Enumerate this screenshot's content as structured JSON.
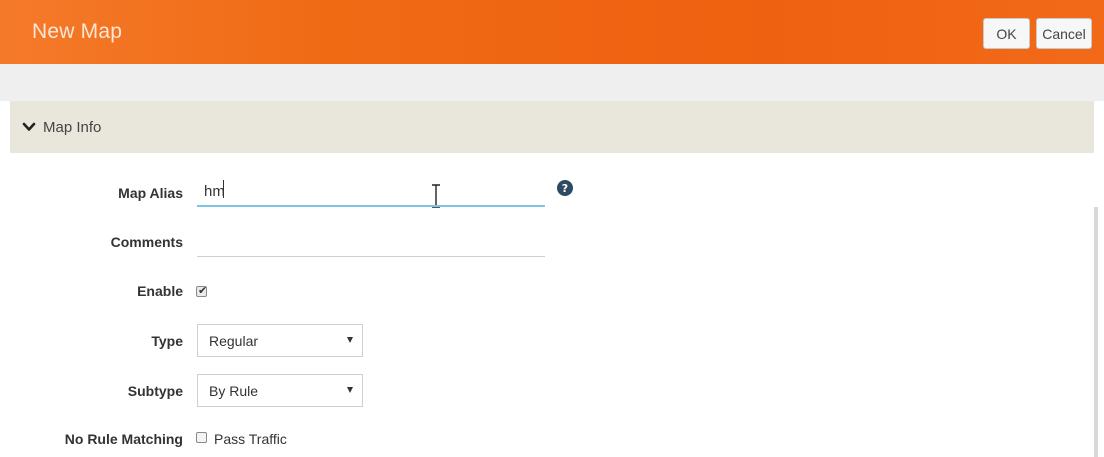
{
  "header": {
    "title": "New Map",
    "ok_label": "OK",
    "cancel_label": "Cancel",
    "accent_color": "#ee6110"
  },
  "section": {
    "title": "Map Info",
    "icon": "chevron-down-icon"
  },
  "form": {
    "map_alias": {
      "label": "Map Alias",
      "value": "hm",
      "help_icon": "question-icon"
    },
    "comments": {
      "label": "Comments",
      "value": ""
    },
    "enable": {
      "label": "Enable",
      "checked": true
    },
    "type": {
      "label": "Type",
      "selected": "Regular"
    },
    "subtype": {
      "label": "Subtype",
      "selected": "By Rule"
    },
    "no_rule_matching": {
      "label": "No Rule Matching",
      "option_label": "Pass Traffic",
      "checked": false
    }
  }
}
